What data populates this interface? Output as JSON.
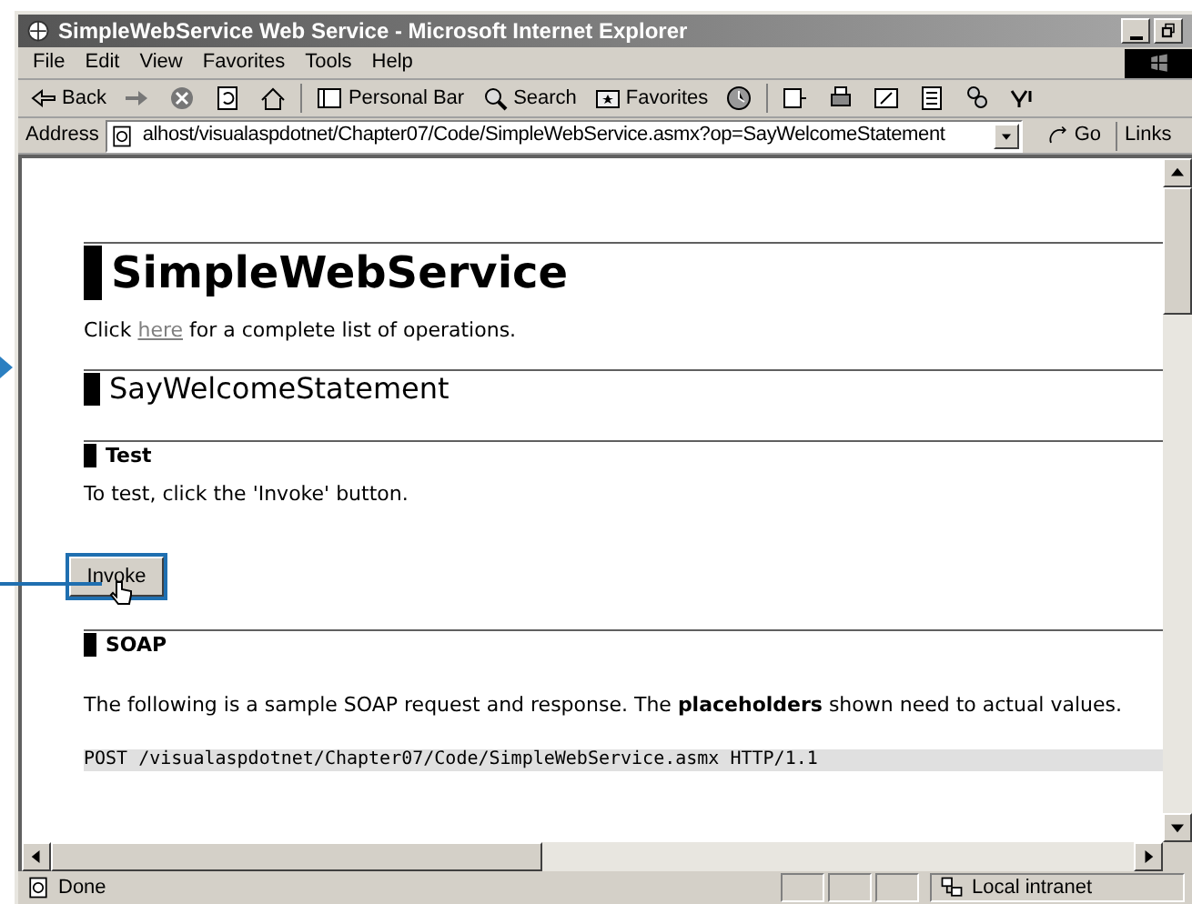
{
  "window": {
    "title": "SimpleWebService Web Service - Microsoft Internet Explorer"
  },
  "menu": [
    "File",
    "Edit",
    "View",
    "Favorites",
    "Tools",
    "Help"
  ],
  "toolbar": [
    {
      "kind": "back",
      "label": "Back"
    },
    {
      "kind": "forward"
    },
    {
      "kind": "stop"
    },
    {
      "kind": "refresh"
    },
    {
      "kind": "home"
    },
    {
      "kind": "personal",
      "label": "Personal Bar"
    },
    {
      "kind": "search",
      "label": "Search"
    },
    {
      "kind": "favorites",
      "label": "Favorites"
    },
    {
      "kind": "history"
    },
    {
      "kind": "mail"
    },
    {
      "kind": "print"
    },
    {
      "kind": "edit"
    },
    {
      "kind": "discuss"
    },
    {
      "kind": "messenger"
    },
    {
      "kind": "yahoo"
    }
  ],
  "address": {
    "label": "Address",
    "value": "alhost/visualaspdotnet/Chapter07/Code/SimpleWebService.asmx?op=SayWelcomeStatement",
    "go": "Go",
    "links": "Links"
  },
  "page": {
    "heading": "SimpleWebService",
    "intro": {
      "before": "Click ",
      "link": "here",
      "after": " for a complete list of operations."
    },
    "operation": "SayWelcomeStatement",
    "test_heading": "Test",
    "test_text": "To test, click the 'Invoke' button.",
    "invoke": "Invoke",
    "soap_heading": "SOAP",
    "soap_text": "The following is a sample SOAP request and response. The **placeholders** shown need to actual values.",
    "code": "POST /visualaspdotnet/Chapter07/Code/SimpleWebService.asmx HTTP/1.1"
  },
  "status_bar": {
    "text": "Done",
    "zone": "Local intranet"
  }
}
